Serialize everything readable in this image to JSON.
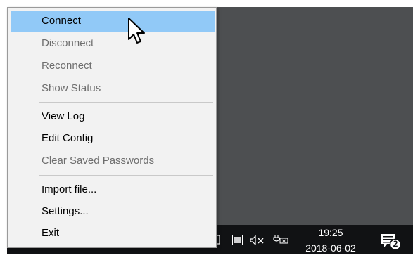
{
  "menu": {
    "items": [
      {
        "label": "Connect",
        "state": "hover"
      },
      {
        "label": "Disconnect",
        "state": "disabled"
      },
      {
        "label": "Reconnect",
        "state": "disabled"
      },
      {
        "label": "Show Status",
        "state": "disabled"
      },
      {
        "label": "View Log",
        "state": "enabled"
      },
      {
        "label": "Edit Config",
        "state": "enabled"
      },
      {
        "label": "Clear Saved Passwords",
        "state": "disabled"
      },
      {
        "label": "Import file...",
        "state": "enabled"
      },
      {
        "label": "Settings...",
        "state": "enabled"
      },
      {
        "label": "Exit",
        "state": "enabled"
      }
    ]
  },
  "taskbar": {
    "clock_time": "19:25",
    "clock_date": "2018-06-02",
    "notification_count": "2",
    "icons": [
      "window-icon",
      "grid-icon",
      "speaker-muted-icon",
      "battery-icon"
    ]
  },
  "colors": {
    "desktop": "#4d4f51",
    "taskbar": "#111214",
    "menu_bg": "#f2f2f2",
    "hover": "#91c9f7",
    "disabled_text": "#6e6e6e"
  }
}
